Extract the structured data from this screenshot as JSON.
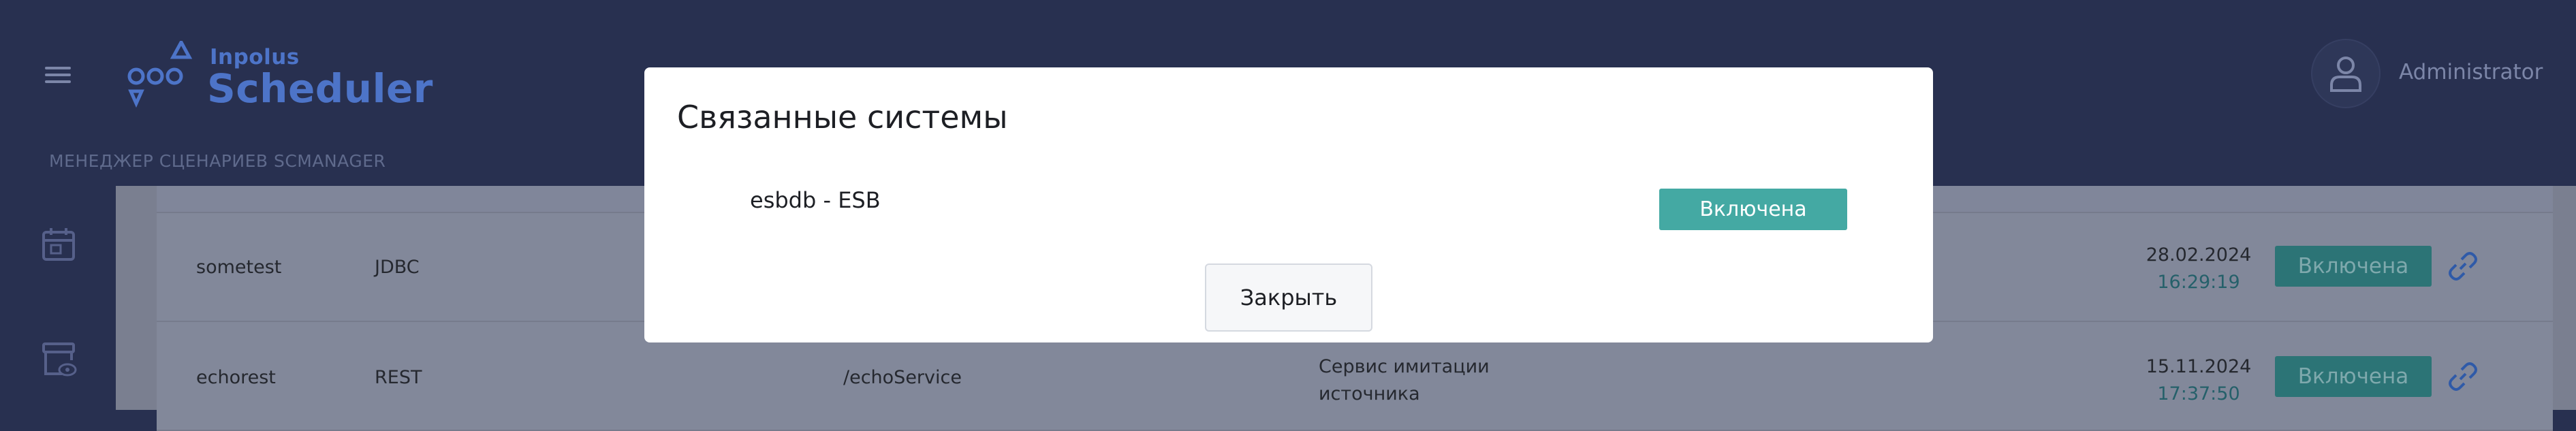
{
  "header": {
    "logo_small": "Inpolus",
    "logo_big": "Scheduler",
    "breadcrumb": "МЕНЕДЖЕР СЦЕНАРИЕВ SCMANAGER",
    "username": "Administrator"
  },
  "table": {
    "rows": [
      {
        "name": "sometest",
        "type": "JDBC",
        "path": "",
        "description_line1": "",
        "description_line2": "",
        "date": "28.02.2024",
        "time": "16:29:19",
        "status": "Включена"
      },
      {
        "name": "echorest",
        "type": "REST",
        "path": "/echoService",
        "description_line1": "Сервис имитации",
        "description_line2": "источника",
        "date": "15.11.2024",
        "time": "17:37:50",
        "status": "Включена"
      }
    ]
  },
  "modal": {
    "title": "Связанные системы",
    "items": [
      {
        "label": "esbdb - ESB",
        "status": "Включена"
      }
    ],
    "close_label": "Закрыть"
  },
  "colors": {
    "header_bg": "#283050",
    "overlay_content": "#7a7f90",
    "modal_badge": "#44a9a3",
    "status_button": "#2c7476"
  },
  "icons": {
    "menu": "hamburger-icon",
    "calendar": "calendar-icon",
    "archive": "archive-eye-icon",
    "user": "user-icon",
    "link": "link-icon"
  }
}
